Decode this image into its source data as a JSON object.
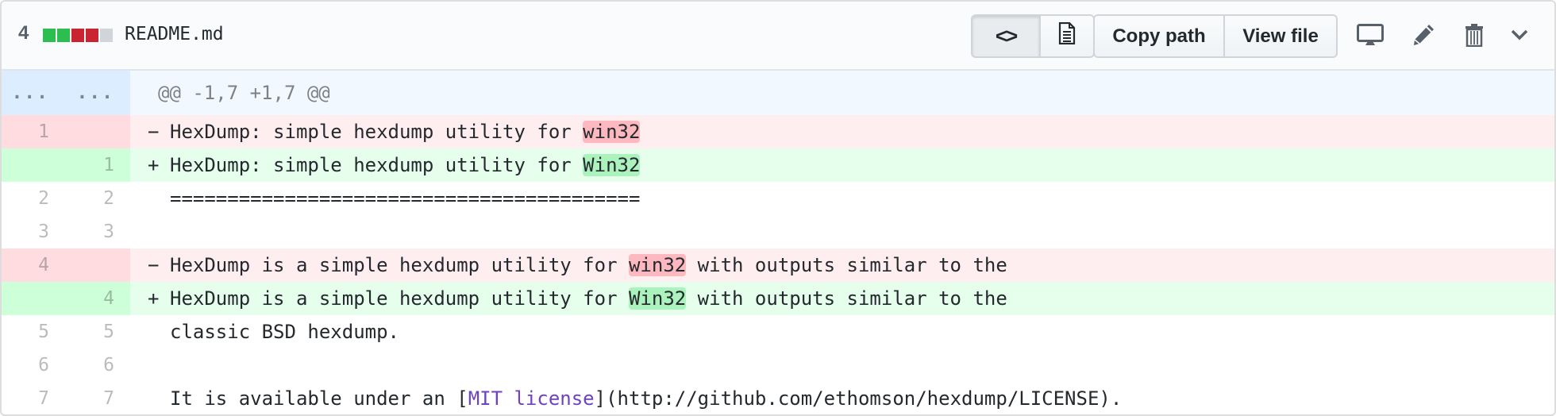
{
  "file_header": {
    "changes_count": "4",
    "diffstat_blocks": [
      {
        "type": "added",
        "color": "#2cbe4e"
      },
      {
        "type": "added",
        "color": "#2cbe4e"
      },
      {
        "type": "deleted",
        "color": "#cb2431"
      },
      {
        "type": "deleted",
        "color": "#cb2431"
      },
      {
        "type": "neutral",
        "color": "#d1d5da"
      }
    ],
    "file_name": "README.md",
    "view_toggle": [
      {
        "name": "source-diff",
        "icon": "code-icon",
        "glyph": "<>",
        "selected": true
      },
      {
        "name": "rich-diff",
        "icon": "file-text-icon",
        "selected": false
      }
    ],
    "copy_path_label": "Copy path",
    "view_file_label": "View file",
    "actions": [
      {
        "name": "open-desktop",
        "icon": "desktop-icon"
      },
      {
        "name": "edit-file",
        "icon": "pencil-icon"
      },
      {
        "name": "delete-file",
        "icon": "trash-icon"
      },
      {
        "name": "more-options",
        "icon": "chevron-down-icon"
      }
    ]
  },
  "diff": {
    "hunk": {
      "left": "...",
      "right": "...",
      "header": "@@ -1,7 +1,7 @@"
    },
    "rows": [
      {
        "type": "del",
        "old": "1",
        "new": "",
        "marker": "-",
        "pre": "HexDump: simple hexdump utility for ",
        "hl": "win32",
        "post": ""
      },
      {
        "type": "add",
        "old": "",
        "new": "1",
        "marker": "+",
        "pre": "HexDump: simple hexdump utility for ",
        "hl": "Win32",
        "post": ""
      },
      {
        "type": "ctx",
        "old": "2",
        "new": "2",
        "marker": " ",
        "pre": "=========================================",
        "hl": "",
        "post": ""
      },
      {
        "type": "ctx",
        "old": "3",
        "new": "3",
        "marker": " ",
        "pre": "",
        "hl": "",
        "post": ""
      },
      {
        "type": "del",
        "old": "4",
        "new": "",
        "marker": "-",
        "pre": "HexDump is a simple hexdump utility for ",
        "hl": "win32",
        "post": " with outputs similar to the"
      },
      {
        "type": "add",
        "old": "",
        "new": "4",
        "marker": "+",
        "pre": "HexDump is a simple hexdump utility for ",
        "hl": "Win32",
        "post": " with outputs similar to the"
      },
      {
        "type": "ctx",
        "old": "5",
        "new": "5",
        "marker": " ",
        "pre": "classic BSD hexdump.",
        "hl": "",
        "post": ""
      },
      {
        "type": "ctx",
        "old": "6",
        "new": "6",
        "marker": " ",
        "pre": "",
        "hl": "",
        "post": ""
      },
      {
        "type": "ctx",
        "old": "7",
        "new": "7",
        "marker": " ",
        "pre": "It is available under an [",
        "link": "MIT license",
        "post": "](http://github.com/ethomson/hexdump/LICENSE)."
      }
    ]
  },
  "colors": {
    "link": "#6f42c1",
    "icon": "#586069"
  }
}
